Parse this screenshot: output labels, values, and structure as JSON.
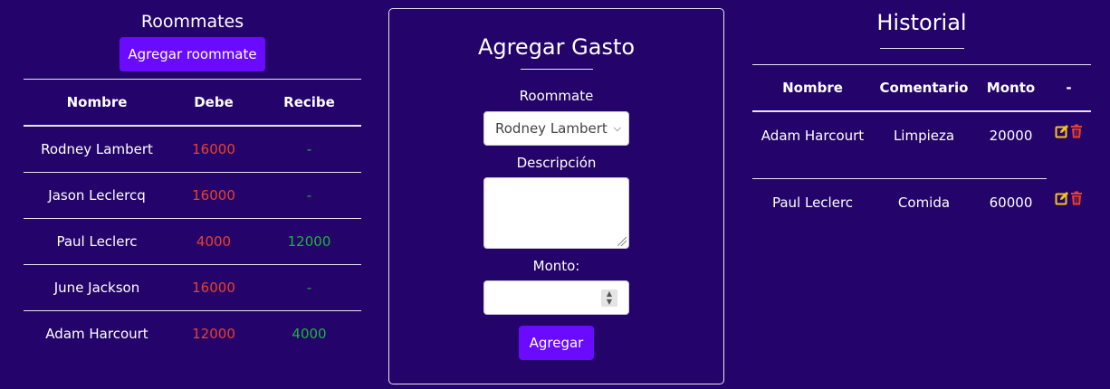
{
  "left": {
    "title": "Roommates",
    "add_button": "Agregar roommate",
    "headers": [
      "Nombre",
      "Debe",
      "Recibe"
    ],
    "rows": [
      {
        "nombre": "Rodney Lambert",
        "debe": "16000",
        "recibe": "-"
      },
      {
        "nombre": "Jason Leclercq",
        "debe": "16000",
        "recibe": "-"
      },
      {
        "nombre": "Paul Leclerc",
        "debe": "4000",
        "recibe": "12000"
      },
      {
        "nombre": "June Jackson",
        "debe": "16000",
        "recibe": "-"
      },
      {
        "nombre": "Adam Harcourt",
        "debe": "12000",
        "recibe": "4000"
      }
    ]
  },
  "form": {
    "title": "Agregar Gasto",
    "roommate_label": "Roommate",
    "roommate_selected": "Rodney Lambert",
    "description_label": "Descripción",
    "amount_label": "Monto:",
    "submit": "Agregar"
  },
  "history": {
    "title": "Historial",
    "headers": [
      "Nombre",
      "Comentario",
      "Monto",
      "-"
    ],
    "rows": [
      {
        "nombre": "Adam Harcourt",
        "comentario": "Limpieza",
        "monto": "20000"
      },
      {
        "nombre": "Paul Leclerc",
        "comentario": "Comida",
        "monto": "60000"
      }
    ]
  },
  "icons": {
    "edit": "edit-icon",
    "delete": "trash-icon"
  },
  "colors": {
    "background": "#24046a",
    "accent": "#6a0aff",
    "debt": "#e8402e",
    "credit": "#1db43a",
    "edit": "#f5c518",
    "delete": "#e8402e"
  }
}
